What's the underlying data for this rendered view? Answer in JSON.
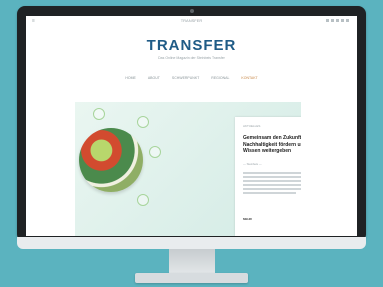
{
  "site": {
    "topbar_title": "TRANSFER",
    "logo": "TRANSFER",
    "tagline": "Das Online Magazin der Steinbeis Transfer"
  },
  "nav": {
    "items": [
      {
        "label": "HOME"
      },
      {
        "label": "ABOUT"
      },
      {
        "label": "SCHWERPUNKT"
      },
      {
        "label": "REGIONAL"
      },
      {
        "label": "KONTAKT",
        "active": true
      }
    ]
  },
  "hero": {
    "card": {
      "category": "AKTUELLES",
      "title": "Gemeinsam den Zukunftsfaktor Nachhaltigkeit fördern und Wissen weitergeben",
      "meta": "— Steinbeis —",
      "more": "MEHR"
    }
  },
  "colors": {
    "background": "#5bb3bf",
    "logo": "#1f5b86",
    "monitor": "#1f2224"
  }
}
